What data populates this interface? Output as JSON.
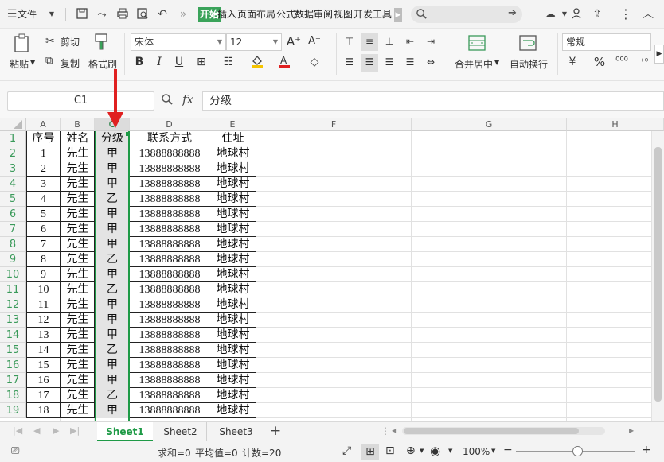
{
  "menubar": {
    "file_label": "文件",
    "tabs": [
      "开始",
      "插入",
      "页面布局",
      "公式",
      "数据",
      "审阅",
      "视图",
      "开发工具"
    ],
    "active_tab": "开始"
  },
  "ribbon": {
    "paste": "粘贴",
    "cut": "剪切",
    "copy": "复制",
    "format_painter": "格式刷",
    "font_name": "宋体",
    "font_size": "12",
    "merge_center": "合并居中",
    "wrap_text": "自动换行",
    "number_format": "常规"
  },
  "formula_bar": {
    "name_box": "C1",
    "fx": "fx",
    "content": "分级"
  },
  "columns": [
    "A",
    "B",
    "C",
    "D",
    "E",
    "F",
    "G",
    "H"
  ],
  "selected_column": "C",
  "row_numbers": [
    "1",
    "2",
    "3",
    "4",
    "5",
    "6",
    "7",
    "8",
    "9",
    "10",
    "11",
    "12",
    "13",
    "14",
    "15",
    "16",
    "17",
    "18",
    "19"
  ],
  "table": {
    "headers": [
      "序号",
      "姓名",
      "分级",
      "联系方式",
      "住址"
    ],
    "rows": [
      [
        "1",
        "先生",
        "甲",
        "13888888888",
        "地球村"
      ],
      [
        "2",
        "先生",
        "甲",
        "13888888888",
        "地球村"
      ],
      [
        "3",
        "先生",
        "甲",
        "13888888888",
        "地球村"
      ],
      [
        "4",
        "先生",
        "乙",
        "13888888888",
        "地球村"
      ],
      [
        "5",
        "先生",
        "甲",
        "13888888888",
        "地球村"
      ],
      [
        "6",
        "先生",
        "甲",
        "13888888888",
        "地球村"
      ],
      [
        "7",
        "先生",
        "甲",
        "13888888888",
        "地球村"
      ],
      [
        "8",
        "先生",
        "乙",
        "13888888888",
        "地球村"
      ],
      [
        "9",
        "先生",
        "甲",
        "13888888888",
        "地球村"
      ],
      [
        "10",
        "先生",
        "乙",
        "13888888888",
        "地球村"
      ],
      [
        "11",
        "先生",
        "甲",
        "13888888888",
        "地球村"
      ],
      [
        "12",
        "先生",
        "甲",
        "13888888888",
        "地球村"
      ],
      [
        "13",
        "先生",
        "甲",
        "13888888888",
        "地球村"
      ],
      [
        "14",
        "先生",
        "乙",
        "13888888888",
        "地球村"
      ],
      [
        "15",
        "先生",
        "甲",
        "13888888888",
        "地球村"
      ],
      [
        "16",
        "先生",
        "甲",
        "13888888888",
        "地球村"
      ],
      [
        "17",
        "先生",
        "乙",
        "13888888888",
        "地球村"
      ],
      [
        "18",
        "先生",
        "甲",
        "13888888888",
        "地球村"
      ]
    ]
  },
  "sheets": [
    "Sheet1",
    "Sheet2",
    "Sheet3"
  ],
  "active_sheet": "Sheet1",
  "status": {
    "sum": "求和=0",
    "average": "平均值=0",
    "count": "计数=20",
    "zoom": "100%"
  },
  "colors": {
    "accent": "#1e9a46",
    "arrow": "#e02020",
    "active_tab_bg": "#3aa35a"
  }
}
